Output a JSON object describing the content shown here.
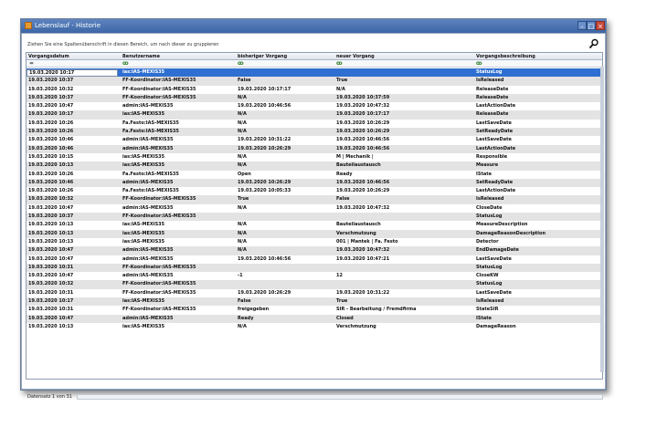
{
  "window": {
    "title": "Lebenslauf - Historie",
    "minimize": "–",
    "maximize": "□",
    "close": "×"
  },
  "group_hint": "Ziehen Sie eine Spaltenüberschrift in diesen Bereich, um nach dieser zu gruppieren",
  "columns": [
    "Vorgangsdatum",
    "Benutzername",
    "bisheriger Vorgang",
    "neuer Vorgang",
    "Vorgangsbeschreibung"
  ],
  "filter": {
    "first": "=",
    "icon": "ꝏ"
  },
  "rows": [
    [
      "19.03.2020 10:17",
      "ias:IAS-MEXIS35",
      "",
      "",
      "StatusLog"
    ],
    [
      "19.03.2020 10:37",
      "FF-Koordinator:IAS-MEXIS35",
      "False",
      "True",
      "IsReleased"
    ],
    [
      "19.03.2020 10:32",
      "FF-Koordinator:IAS-MEXIS35",
      "19.03.2020 10:17:17",
      "N/A",
      "ReleaseDate"
    ],
    [
      "19.03.2020 10:37",
      "FF-Koordinator:IAS-MEXIS35",
      "N/A",
      "19.03.2020 10:37:59",
      "ReleaseDate"
    ],
    [
      "19.03.2020 10:47",
      "admin:IAS-MEXIS35",
      "19.03.2020 10:46:56",
      "19.03.2020 10:47:32",
      "LastActionDate"
    ],
    [
      "19.03.2020 10:17",
      "ias:IAS-MEXIS35",
      "N/A",
      "19.03.2020 10:17:17",
      "ReleaseDate"
    ],
    [
      "19.03.2020 10:26",
      "Fa.Festo:IAS-MEXIS35",
      "N/A",
      "19.03.2020 10:26:29",
      "LastSaveDate"
    ],
    [
      "19.03.2020 10:26",
      "Fa.Festo:IAS-MEXIS35",
      "N/A",
      "19.03.2020 10:26:29",
      "SetReadyDate"
    ],
    [
      "19.03.2020 10:46",
      "admin:IAS-MEXIS35",
      "19.03.2020 10:31:22",
      "19.03.2020 10:46:56",
      "LastSaveDate"
    ],
    [
      "19.03.2020 10:46",
      "admin:IAS-MEXIS35",
      "19.03.2020 10:26:29",
      "19.03.2020 10:46:56",
      "LastActionDate"
    ],
    [
      "19.03.2020 10:15",
      "ias:IAS-MEXIS35",
      "N/A",
      "M | Mechanik |",
      "Responsible"
    ],
    [
      "19.03.2020 10:13",
      "ias:IAS-MEXIS35",
      "N/A",
      "Bauteilaustausch",
      "Measure"
    ],
    [
      "19.03.2020 10:26",
      "Fa.Festo:IAS-MEXIS35",
      "Open",
      "Ready",
      "IState"
    ],
    [
      "19.03.2020 10:46",
      "admin:IAS-MEXIS35",
      "19.03.2020 10:26:29",
      "19.03.2020 10:46:56",
      "SetReadyDate"
    ],
    [
      "19.03.2020 10:26",
      "Fa.Festo:IAS-MEXIS35",
      "19.03.2020 10:05:33",
      "19.03.2020 10:26:29",
      "LastActionDate"
    ],
    [
      "19.03.2020 10:32",
      "FF-Koordinator:IAS-MEXIS35",
      "True",
      "False",
      "IsReleased"
    ],
    [
      "19.03.2020 10:47",
      "admin:IAS-MEXIS35",
      "N/A",
      "19.03.2020 10:47:32",
      "CloseDate"
    ],
    [
      "19.03.2020 10:37",
      "FF-Koordinator:IAS-MEXIS35",
      "",
      "",
      "StatusLog"
    ],
    [
      "19.03.2020 10:13",
      "ias:IAS-MEXIS35",
      "N/A",
      "Bauteilaustausch",
      "MeasureDescription"
    ],
    [
      "19.03.2020 10:13",
      "ias:IAS-MEXIS35",
      "N/A",
      "Verschmutzung",
      "DamageReasonDescription"
    ],
    [
      "19.03.2020 10:13",
      "ias:IAS-MEXIS35",
      "N/A",
      "001 | Mantek | Fa. Festo",
      "Detector"
    ],
    [
      "19.03.2020 10:47",
      "admin:IAS-MEXIS35",
      "N/A",
      "19.03.2020 10:47:32",
      "EndDamageDate"
    ],
    [
      "19.03.2020 10:47",
      "admin:IAS-MEXIS35",
      "19.03.2020 10:46:56",
      "19.03.2020 10:47:21",
      "LastSaveDate"
    ],
    [
      "19.03.2020 10:31",
      "FF-Koordinator:IAS-MEXIS35",
      "",
      "",
      "StatusLog"
    ],
    [
      "19.03.2020 10:47",
      "admin:IAS-MEXIS35",
      "-1",
      "12",
      "CloseKW"
    ],
    [
      "19.03.2020 10:32",
      "FF-Koordinator:IAS-MEXIS35",
      "",
      "",
      "StatusLog"
    ],
    [
      "19.03.2020 10:31",
      "FF-Koordinator:IAS-MEXIS35",
      "19.03.2020 10:26:29",
      "19.03.2020 10:31:22",
      "LastSaveDate"
    ],
    [
      "19.03.2020 10:17",
      "ias:IAS-MEXIS35",
      "False",
      "True",
      "IsReleased"
    ],
    [
      "19.03.2020 10:31",
      "FF-Koordinator:IAS-MEXIS35",
      "freigegeben",
      "SIR - Bearbeitung / Fremdfirma",
      "StateSIR"
    ],
    [
      "19.03.2020 10:47",
      "admin:IAS-MEXIS35",
      "Ready",
      "Closed",
      "IState"
    ],
    [
      "19.03.2020 10:13",
      "ias:IAS-MEXIS35",
      "N/A",
      "Verschmutzung",
      "DamageReason"
    ]
  ],
  "footer": {
    "record_text": "Datensatz 1 von 31"
  },
  "colors": {
    "selection": "#2e6fd1",
    "alt_row": "#e3e3e3",
    "titlebar": "#3c66a6"
  }
}
